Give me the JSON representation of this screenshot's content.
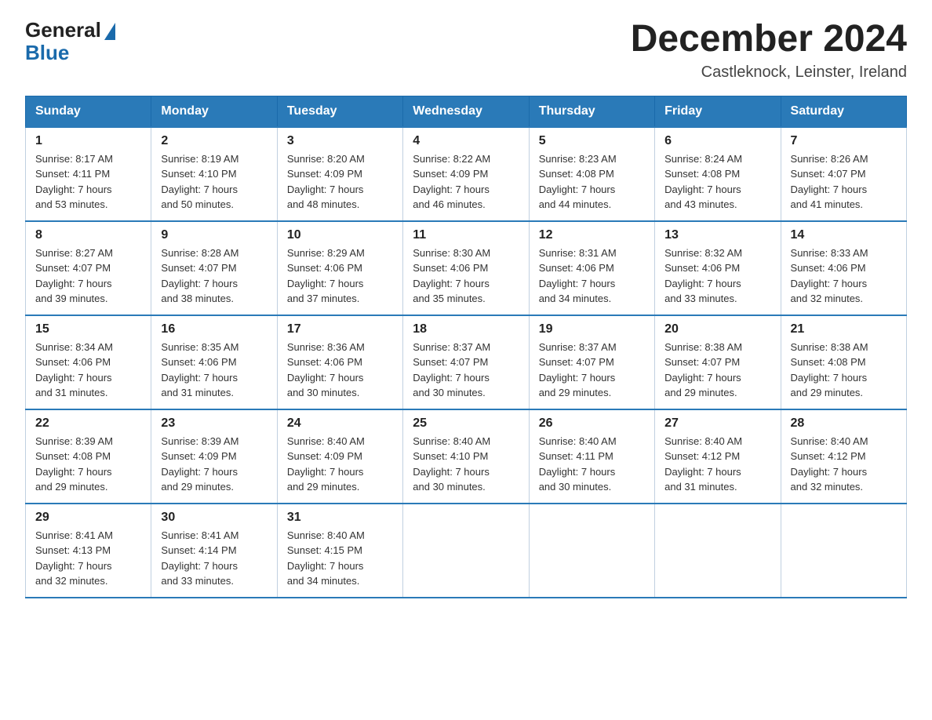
{
  "header": {
    "logo_general": "General",
    "logo_blue": "Blue",
    "month": "December 2024",
    "location": "Castleknock, Leinster, Ireland"
  },
  "weekdays": [
    "Sunday",
    "Monday",
    "Tuesday",
    "Wednesday",
    "Thursday",
    "Friday",
    "Saturday"
  ],
  "weeks": [
    [
      {
        "day": "1",
        "info": "Sunrise: 8:17 AM\nSunset: 4:11 PM\nDaylight: 7 hours\nand 53 minutes."
      },
      {
        "day": "2",
        "info": "Sunrise: 8:19 AM\nSunset: 4:10 PM\nDaylight: 7 hours\nand 50 minutes."
      },
      {
        "day": "3",
        "info": "Sunrise: 8:20 AM\nSunset: 4:09 PM\nDaylight: 7 hours\nand 48 minutes."
      },
      {
        "day": "4",
        "info": "Sunrise: 8:22 AM\nSunset: 4:09 PM\nDaylight: 7 hours\nand 46 minutes."
      },
      {
        "day": "5",
        "info": "Sunrise: 8:23 AM\nSunset: 4:08 PM\nDaylight: 7 hours\nand 44 minutes."
      },
      {
        "day": "6",
        "info": "Sunrise: 8:24 AM\nSunset: 4:08 PM\nDaylight: 7 hours\nand 43 minutes."
      },
      {
        "day": "7",
        "info": "Sunrise: 8:26 AM\nSunset: 4:07 PM\nDaylight: 7 hours\nand 41 minutes."
      }
    ],
    [
      {
        "day": "8",
        "info": "Sunrise: 8:27 AM\nSunset: 4:07 PM\nDaylight: 7 hours\nand 39 minutes."
      },
      {
        "day": "9",
        "info": "Sunrise: 8:28 AM\nSunset: 4:07 PM\nDaylight: 7 hours\nand 38 minutes."
      },
      {
        "day": "10",
        "info": "Sunrise: 8:29 AM\nSunset: 4:06 PM\nDaylight: 7 hours\nand 37 minutes."
      },
      {
        "day": "11",
        "info": "Sunrise: 8:30 AM\nSunset: 4:06 PM\nDaylight: 7 hours\nand 35 minutes."
      },
      {
        "day": "12",
        "info": "Sunrise: 8:31 AM\nSunset: 4:06 PM\nDaylight: 7 hours\nand 34 minutes."
      },
      {
        "day": "13",
        "info": "Sunrise: 8:32 AM\nSunset: 4:06 PM\nDaylight: 7 hours\nand 33 minutes."
      },
      {
        "day": "14",
        "info": "Sunrise: 8:33 AM\nSunset: 4:06 PM\nDaylight: 7 hours\nand 32 minutes."
      }
    ],
    [
      {
        "day": "15",
        "info": "Sunrise: 8:34 AM\nSunset: 4:06 PM\nDaylight: 7 hours\nand 31 minutes."
      },
      {
        "day": "16",
        "info": "Sunrise: 8:35 AM\nSunset: 4:06 PM\nDaylight: 7 hours\nand 31 minutes."
      },
      {
        "day": "17",
        "info": "Sunrise: 8:36 AM\nSunset: 4:06 PM\nDaylight: 7 hours\nand 30 minutes."
      },
      {
        "day": "18",
        "info": "Sunrise: 8:37 AM\nSunset: 4:07 PM\nDaylight: 7 hours\nand 30 minutes."
      },
      {
        "day": "19",
        "info": "Sunrise: 8:37 AM\nSunset: 4:07 PM\nDaylight: 7 hours\nand 29 minutes."
      },
      {
        "day": "20",
        "info": "Sunrise: 8:38 AM\nSunset: 4:07 PM\nDaylight: 7 hours\nand 29 minutes."
      },
      {
        "day": "21",
        "info": "Sunrise: 8:38 AM\nSunset: 4:08 PM\nDaylight: 7 hours\nand 29 minutes."
      }
    ],
    [
      {
        "day": "22",
        "info": "Sunrise: 8:39 AM\nSunset: 4:08 PM\nDaylight: 7 hours\nand 29 minutes."
      },
      {
        "day": "23",
        "info": "Sunrise: 8:39 AM\nSunset: 4:09 PM\nDaylight: 7 hours\nand 29 minutes."
      },
      {
        "day": "24",
        "info": "Sunrise: 8:40 AM\nSunset: 4:09 PM\nDaylight: 7 hours\nand 29 minutes."
      },
      {
        "day": "25",
        "info": "Sunrise: 8:40 AM\nSunset: 4:10 PM\nDaylight: 7 hours\nand 30 minutes."
      },
      {
        "day": "26",
        "info": "Sunrise: 8:40 AM\nSunset: 4:11 PM\nDaylight: 7 hours\nand 30 minutes."
      },
      {
        "day": "27",
        "info": "Sunrise: 8:40 AM\nSunset: 4:12 PM\nDaylight: 7 hours\nand 31 minutes."
      },
      {
        "day": "28",
        "info": "Sunrise: 8:40 AM\nSunset: 4:12 PM\nDaylight: 7 hours\nand 32 minutes."
      }
    ],
    [
      {
        "day": "29",
        "info": "Sunrise: 8:41 AM\nSunset: 4:13 PM\nDaylight: 7 hours\nand 32 minutes."
      },
      {
        "day": "30",
        "info": "Sunrise: 8:41 AM\nSunset: 4:14 PM\nDaylight: 7 hours\nand 33 minutes."
      },
      {
        "day": "31",
        "info": "Sunrise: 8:40 AM\nSunset: 4:15 PM\nDaylight: 7 hours\nand 34 minutes."
      },
      null,
      null,
      null,
      null
    ]
  ]
}
